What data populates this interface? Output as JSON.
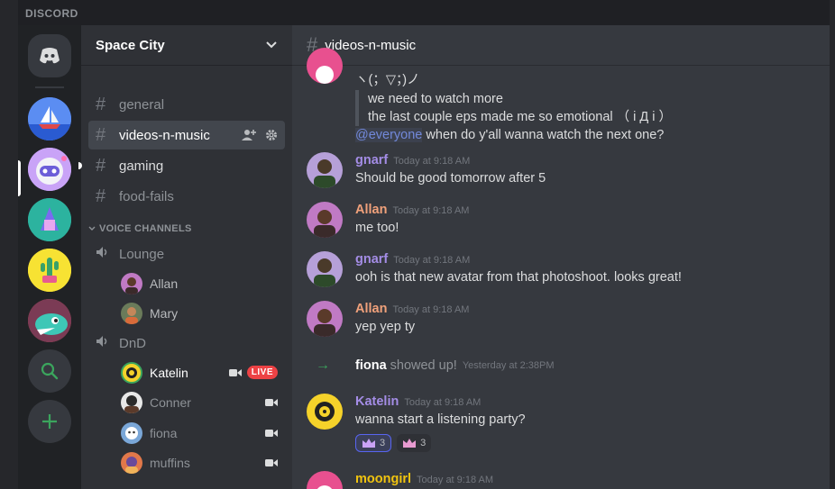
{
  "titlebar": {
    "brand": "DISCORD"
  },
  "servers": [
    {
      "name": "Discord Home",
      "color": "#36393f",
      "icon": "discord-icon"
    },
    {
      "name": "Sailboat",
      "color": "#4f7be0",
      "icon": "sailboat-icon"
    },
    {
      "name": "Space City",
      "color": "#b18cf5",
      "icon": "robot-icon"
    },
    {
      "name": "Teal",
      "color": "#2cb39f",
      "icon": "bag-icon"
    },
    {
      "name": "Cactus",
      "color": "#f7e233",
      "icon": "cactus-icon"
    },
    {
      "name": "Dino",
      "color": "#c84b4b",
      "icon": "dino-icon"
    }
  ],
  "server_actions": {
    "explore_icon": "search-icon",
    "add_icon": "plus-icon"
  },
  "guild": {
    "name": "Space City"
  },
  "text_channels": [
    {
      "name": "general",
      "active": false
    },
    {
      "name": "videos-n-music",
      "active": true
    },
    {
      "name": "gaming",
      "active": false,
      "unread": true
    },
    {
      "name": "food-fails",
      "active": false
    }
  ],
  "voice_category": "VOICE CHANNELS",
  "voice_channels": [
    {
      "name": "Lounge",
      "users": [
        {
          "name": "Allan",
          "color": "#c07ac4"
        },
        {
          "name": "Mary",
          "color": "#6a7b5a"
        }
      ]
    },
    {
      "name": "DnD",
      "users": [
        {
          "name": "Katelin",
          "color": "#f5d22a",
          "video": true,
          "live": "LIVE"
        },
        {
          "name": "Conner",
          "color": "#2b2b2b",
          "video": true,
          "dim": true
        },
        {
          "name": "fiona",
          "color": "#7aa7d8",
          "video": true,
          "dim": true
        },
        {
          "name": "muffins",
          "color": "#e1784a",
          "video": true,
          "dim": true
        }
      ]
    }
  ],
  "chat": {
    "channel": "videos-n-music",
    "top": {
      "line1": "ヽ(；▽；)ノ",
      "quote1": "we need to watch more",
      "quote2": "the last couple eps made me so emotional （ i Д i ）",
      "mention": "@everyone",
      "rest": " when do y'all wanna watch the next one?"
    },
    "messages": [
      {
        "author": "gnarf",
        "color": "#a48de6",
        "time": "Today at 9:18 AM",
        "text": "Should be good tomorrow after 5"
      },
      {
        "author": "Allan",
        "color": "#f0a17b",
        "time": "Today at 9:18 AM",
        "text": "me too!"
      },
      {
        "author": "gnarf",
        "color": "#a48de6",
        "time": "Today at 9:18 AM",
        "text": "ooh is that new avatar from that photoshoot. looks great!"
      },
      {
        "author": "Allan",
        "color": "#f0a17b",
        "time": "Today at 9:18 AM",
        "text": "yep yep ty"
      }
    ],
    "join": {
      "user": "fiona",
      "text": "showed up!",
      "time": "Yesterday at 2:38PM"
    },
    "katelin": {
      "author": "Katelin",
      "color": "#a48de6",
      "time": "Today at 9:18 AM",
      "text": "wanna start a listening party?",
      "reactions": [
        {
          "count": "3"
        },
        {
          "count": "3"
        }
      ]
    },
    "last": {
      "author": "moongirl",
      "color": "#f1c40f",
      "time": "Today at 9:18 AM"
    }
  }
}
